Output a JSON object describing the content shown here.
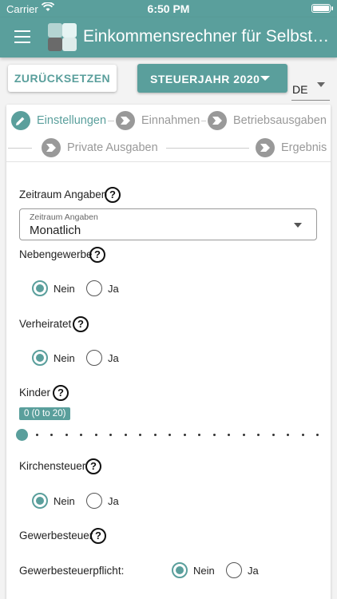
{
  "status_bar": {
    "carrier": "Carrier",
    "time": "6:50 PM"
  },
  "app_bar": {
    "title": "Einkommensrechner für Selbständige"
  },
  "toolbar": {
    "reset_label": "ZURÜCKSETZEN",
    "year_label": "STEUERJAHR 2020",
    "language": "DE"
  },
  "stepper": {
    "steps": [
      {
        "label": "Einstellungen",
        "active": true
      },
      {
        "label": "Einnahmen"
      },
      {
        "label": "Betriebsausgaben"
      },
      {
        "label": "Private Ausgaben"
      },
      {
        "label": "Ergebnis"
      }
    ]
  },
  "form": {
    "zeitraum": {
      "label": "Zeitraum Angaben",
      "field_label": "Zeitraum Angaben",
      "value": "Monatlich"
    },
    "nebengewerbe": {
      "label": "Nebengewerbe",
      "options": [
        "Nein",
        "Ja"
      ],
      "selected": "Nein"
    },
    "verheiratet": {
      "label": "Verheiratet",
      "options": [
        "Nein",
        "Ja"
      ],
      "selected": "Nein"
    },
    "kinder": {
      "label": "Kinder",
      "value_text": "0 (0 to 20)",
      "value": 0,
      "min": 0,
      "max": 20
    },
    "kirchensteuer": {
      "label": "Kirchensteuer",
      "options": [
        "Nein",
        "Ja"
      ],
      "selected": "Nein"
    },
    "gewerbesteuer": {
      "label": "Gewerbesteuer"
    },
    "gewerbesteuerpflicht": {
      "label": "Gewerbesteuerpflicht:",
      "options": [
        "Nein",
        "Ja"
      ],
      "selected": "Nein"
    }
  },
  "help_glyph": "?",
  "colors": {
    "accent": "#5a9f9c",
    "inactive": "#999999"
  }
}
